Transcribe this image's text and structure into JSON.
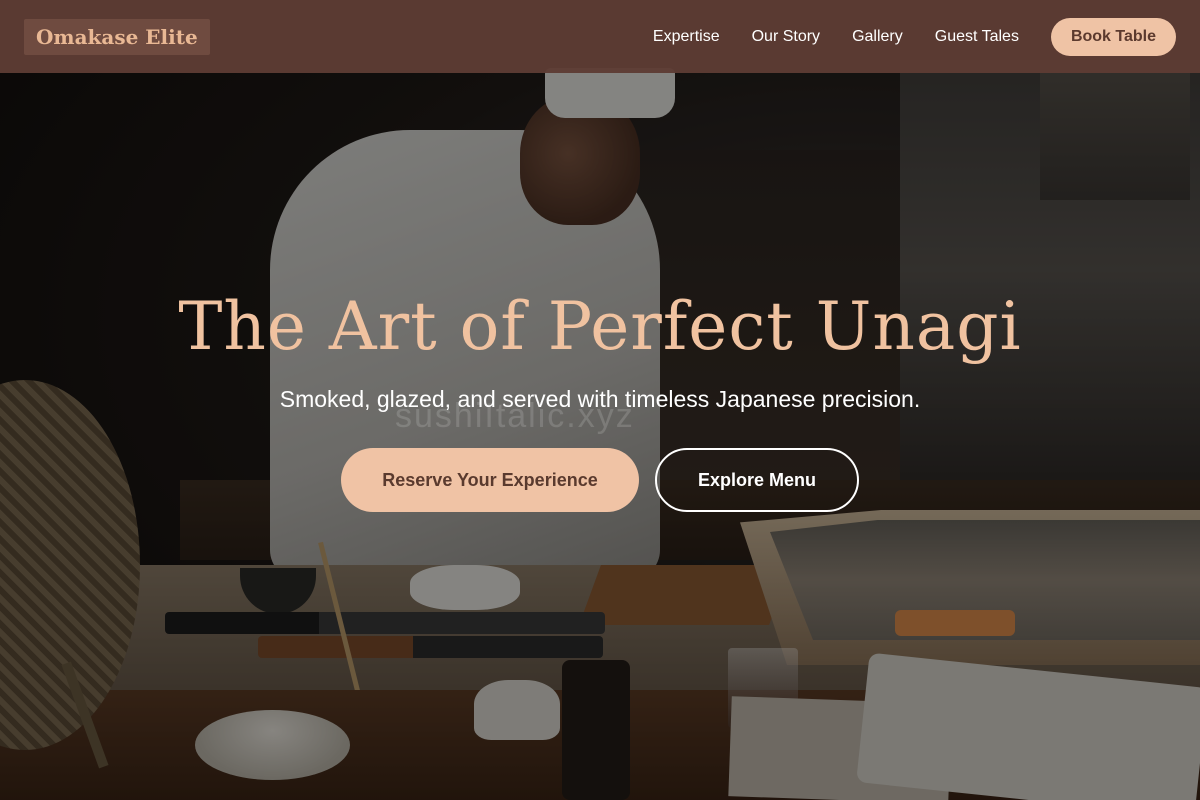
{
  "nav": {
    "brand": "Omakase Elite",
    "links": [
      "Expertise",
      "Our Story",
      "Gallery",
      "Guest Tales"
    ],
    "book_label": "Book Table"
  },
  "hero": {
    "title": "The Art of Perfect Unagi",
    "subtitle": "Smoked, glazed, and served with timeless Japanese precision.",
    "watermark": "sushiItalic.xyz",
    "primary_cta": "Reserve Your Experience",
    "secondary_cta": "Explore Menu",
    "background_image": "sushi chef preparing food at counter"
  },
  "colors": {
    "nav_bg": "#5e3c34",
    "accent": "#f0c3a5",
    "title": "#f0c2a0",
    "button_text": "#5a3a2e"
  }
}
